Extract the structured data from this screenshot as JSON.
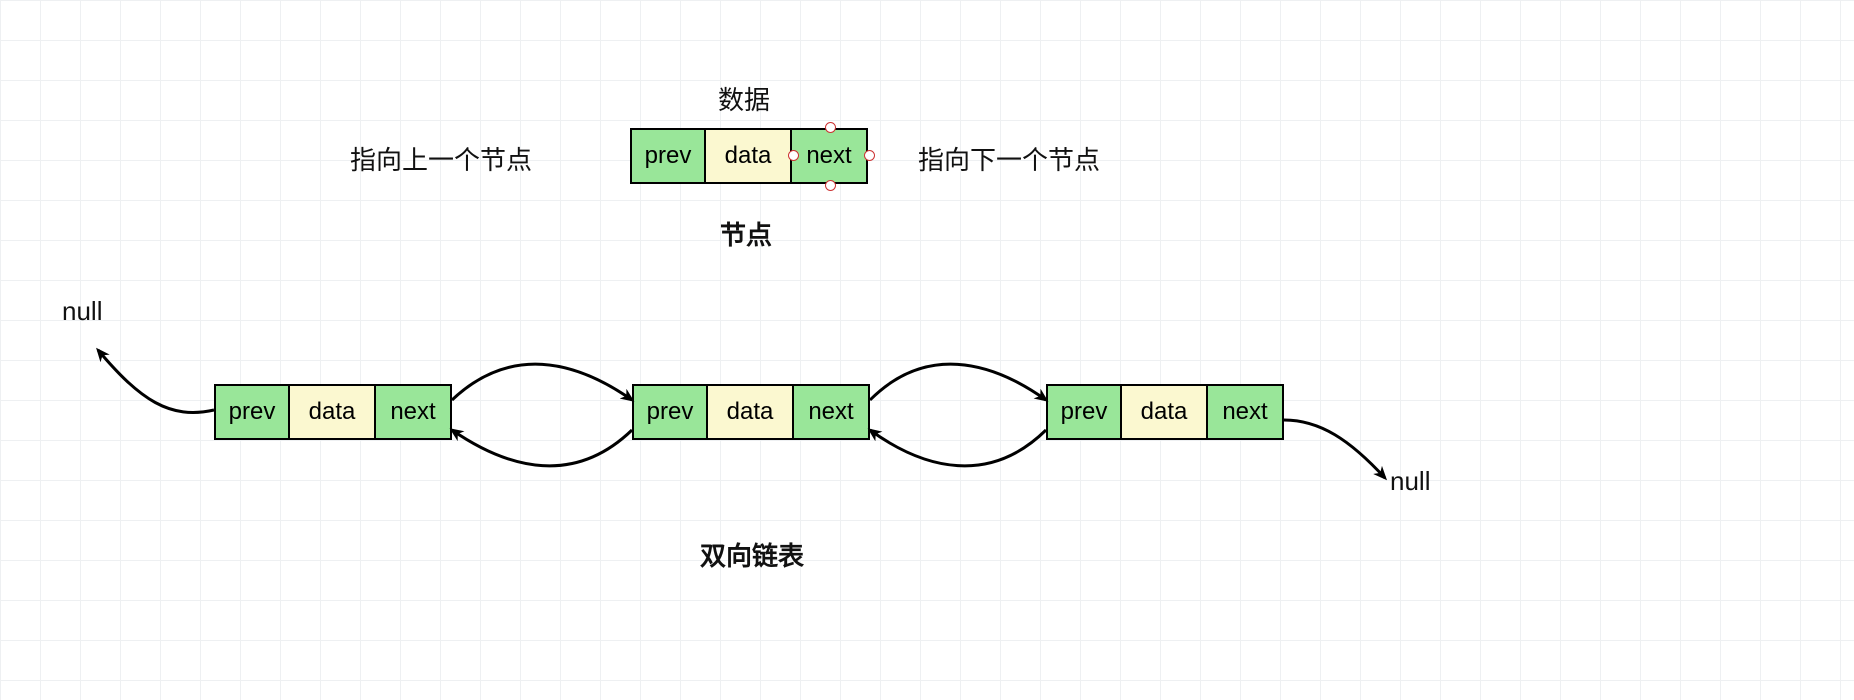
{
  "labels": {
    "data_top": "数据",
    "prev_hint": "指向上一个节点",
    "next_hint": "指向下一个节点",
    "node_caption": "节点",
    "list_caption": "双向链表",
    "null_left": "null",
    "null_right": "null"
  },
  "cells": {
    "prev": "prev",
    "data": "data",
    "next": "next"
  }
}
